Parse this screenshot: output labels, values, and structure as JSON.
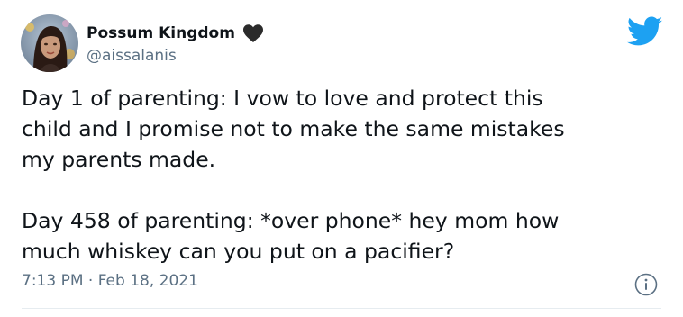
{
  "author": {
    "display_name": "Possum Kingdom",
    "handle": "@aissalanis",
    "avatar_icon": "user-avatar-photo",
    "badge_icon": "black-heart-icon"
  },
  "tweet": {
    "paragraphs": [
      {
        "lines": [
          "Day 1 of parenting: I vow to love and protect this",
          "child and I promise not to make the same mistakes",
          "my parents made."
        ]
      },
      {
        "lines": [
          "Day 458 of parenting: *over phone* hey mom how",
          "much whiskey can you put on a pacifier?"
        ]
      }
    ],
    "timestamp": "7:13 PM · Feb 18, 2021"
  },
  "icons": {
    "brand": "twitter-bird-icon",
    "info": "info-icon"
  },
  "colors": {
    "twitter_blue": "#1da1f2",
    "secondary_text": "#5b7083",
    "primary_text": "#0f1419",
    "divider": "#e6ecf0"
  }
}
